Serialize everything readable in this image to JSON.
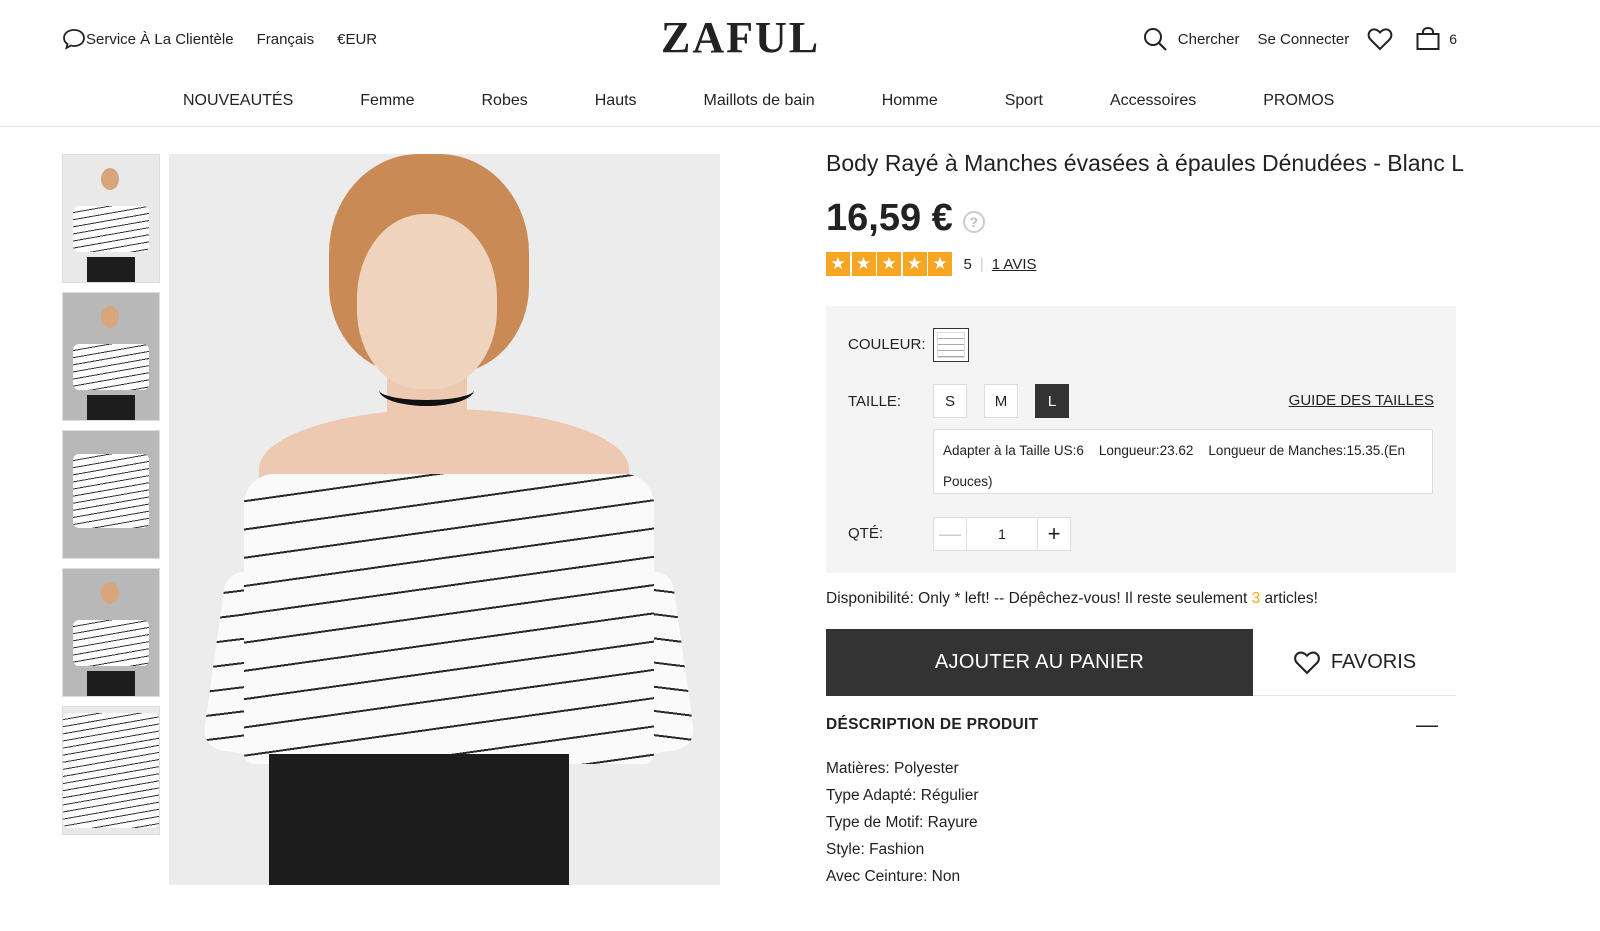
{
  "header": {
    "service_label": "Service À La Clientèle",
    "language": "Français",
    "currency": "€EUR",
    "logo": "ZAFUL",
    "search_label": "Chercher",
    "login_label": "Se Connecter",
    "cart_count": "6"
  },
  "nav": {
    "items": [
      "NOUVEAUTÉS",
      "Femme",
      "Robes",
      "Hauts",
      "Maillots de bain",
      "Homme",
      "Sport",
      "Accessoires",
      "PROMOS"
    ]
  },
  "product": {
    "title": "Body Rayé à Manches évasées à épaules Dénudées - Blanc L",
    "price": "16,59 €",
    "help_symbol": "?",
    "rating": "5",
    "reviews_label": "1 AVIS",
    "color_label": "COULEUR:",
    "size_label": "TAILLE:",
    "sizes": [
      "S",
      "M",
      "L"
    ],
    "selected_size": "L",
    "size_guide_label": "GUIDE DES TAILLES",
    "size_info": "Adapter à la Taille US:6    Longueur:23.62    Longueur de Manches:15.35.(En Pouces)",
    "qty_label": "QTÉ:",
    "qty_value": "1",
    "availability_prefix": "Disponibilité: Only * left! -- Dépêchez-vous! Il reste seulement ",
    "availability_count": "3",
    "availability_suffix": " articles!",
    "add_to_cart_label": "AJOUTER AU PANIER",
    "favorites_label": "FAVORIS",
    "description_title": "DÉSCRIPTION DE PRODUIT",
    "description": [
      "Matières: Polyester",
      "Type Adapté: Régulier",
      "Type de Motif: Rayure",
      "Style: Fashion",
      "Avec Ceinture: Non"
    ]
  },
  "colors": {
    "accent": "#f6a623",
    "dark_button": "#333333",
    "options_bg": "#f4f4f4"
  }
}
